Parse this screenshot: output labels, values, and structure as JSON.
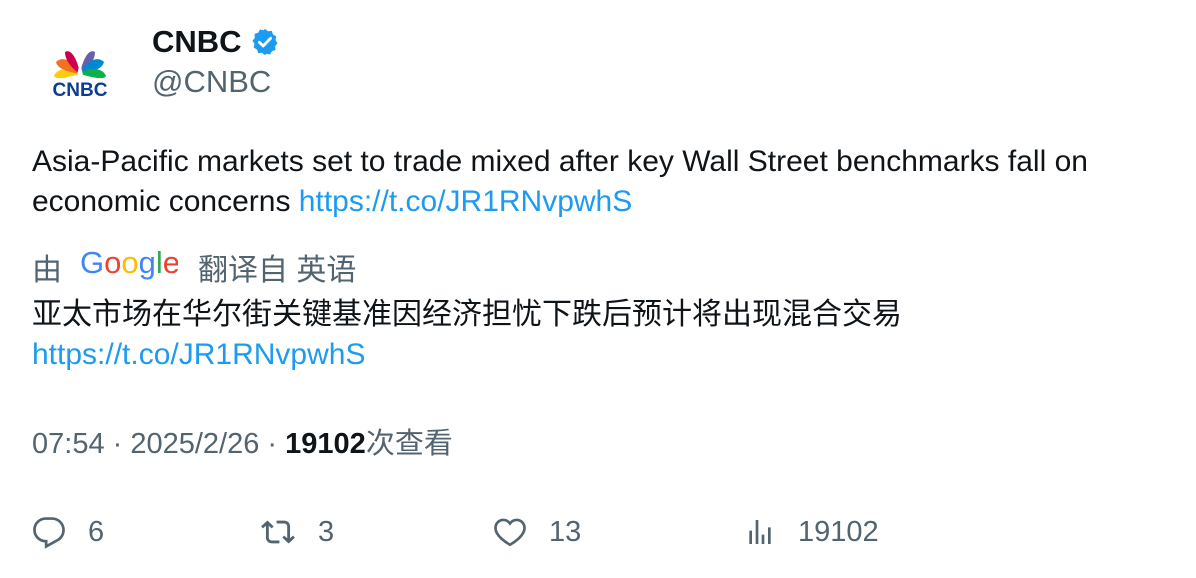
{
  "author": {
    "name": "CNBC",
    "handle": "@CNBC",
    "avatar_icon": "cnbc-peacock-logo",
    "verified_icon": "verified-badge-icon",
    "verified_color": "#1d9bf0"
  },
  "tweet": {
    "text": "Asia-Pacific markets set to trade mixed after key Wall Street benchmarks fall on economic concerns ",
    "link": "https://t.co/JR1RNvpwhS"
  },
  "translation": {
    "by_label": "由",
    "provider_icon": "google-logo",
    "from_label": "翻译自 英语",
    "text": "亚太市场在华尔街关键基准因经济担忧下跌后预计将出现混合交易",
    "link": "https://t.co/JR1RNvpwhS"
  },
  "meta": {
    "time": "07:54",
    "separator": " · ",
    "date": "2025/2/26",
    "views_count": "19102",
    "views_label": "次查看"
  },
  "actions": {
    "replies": "6",
    "retweets": "3",
    "likes": "13",
    "views": "19102"
  },
  "colors": {
    "text_primary": "#0f1419",
    "text_secondary": "#536471",
    "link": "#1d9bf0"
  }
}
